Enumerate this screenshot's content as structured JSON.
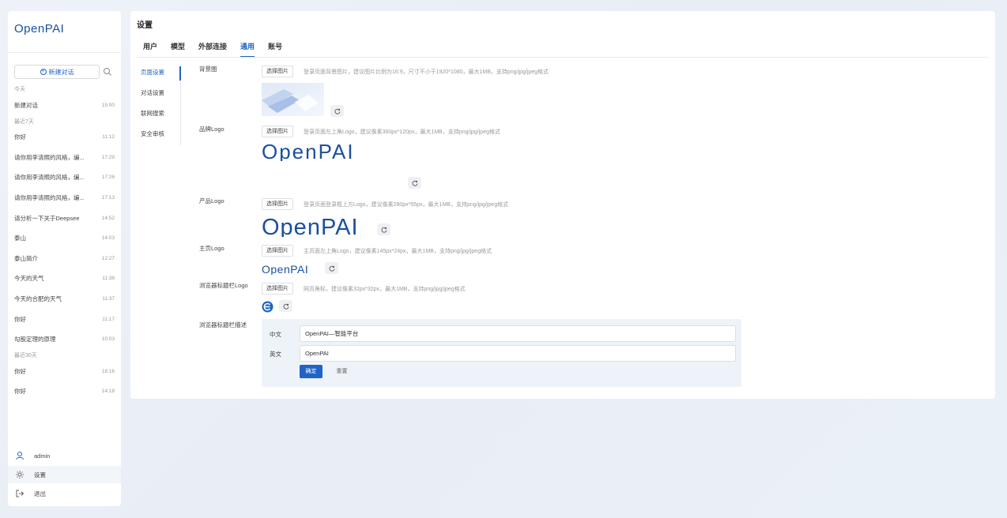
{
  "app": {
    "brand": "OpenPAI"
  },
  "sidebar": {
    "new_chat_label": "新建对话",
    "groups": [
      {
        "label": "今天",
        "items": [
          {
            "title": "新建对话",
            "time": "15:00"
          }
        ]
      },
      {
        "label": "最近7天",
        "items": [
          {
            "title": "你好",
            "time": "11:12"
          },
          {
            "title": "请你用李清照的风格，编...",
            "time": "17:29"
          },
          {
            "title": "请你用李清照的风格，编...",
            "time": "17:26"
          },
          {
            "title": "请你用李清照的风格，编...",
            "time": "17:13"
          },
          {
            "title": "请分析一下关于Deepsee",
            "time": "14:52"
          },
          {
            "title": "泰山",
            "time": "14:03"
          },
          {
            "title": "泰山简介",
            "time": "12:27"
          },
          {
            "title": "今天的天气",
            "time": "11:38"
          },
          {
            "title": "今天的合肥的天气",
            "time": "11:37"
          },
          {
            "title": "你好",
            "time": "11:17"
          },
          {
            "title": "勾股定理的原理",
            "time": "10:03"
          }
        ]
      },
      {
        "label": "最近30天",
        "items": [
          {
            "title": "你好",
            "time": "18:16"
          },
          {
            "title": "你好",
            "time": "14:18"
          }
        ]
      }
    ],
    "user": "admin",
    "settings_label": "设置",
    "logout_label": "退出"
  },
  "main": {
    "title": "设置",
    "tabs": [
      {
        "label": "用户",
        "active": false
      },
      {
        "label": "模型",
        "active": false
      },
      {
        "label": "外部连接",
        "active": false
      },
      {
        "label": "通用",
        "active": true
      },
      {
        "label": "账号",
        "active": false
      }
    ],
    "subnav": [
      {
        "label": "页面设置",
        "active": true
      },
      {
        "label": "对话设置",
        "active": false
      },
      {
        "label": "联网搜索",
        "active": false
      },
      {
        "label": "安全审核",
        "active": false
      }
    ],
    "pick_label": "选择图片",
    "rows": {
      "background": {
        "label": "背景图",
        "hint": "登录页面背景图片，建议图片比例为16:9，尺寸不小于1920*1080，最大1MB，支持png/jpg/jpeg格式"
      },
      "brand_logo": {
        "label": "品牌Logo",
        "hint": "登录页面左上角Logo，建议像素360px*120px，最大1MB，支持png/jpg/jpeg格式"
      },
      "product_logo": {
        "label": "产品Logo",
        "hint": "登录页面登录框上方Logo，建议像素280px*55px，最大1MB，支持png/jpg/jpeg格式"
      },
      "home_logo": {
        "label": "主页Logo",
        "hint": "主页面左上角Logo，建议像素145px*24px，最大1MB，支持png/jpg/jpeg格式"
      },
      "favicon": {
        "label": "浏览器标题栏Logo",
        "hint": "网页角标，建议像素32px*32px，最大1MB，支持png/jpg/jpeg格式"
      },
      "browser_desc": {
        "label": "浏览器标题栏描述"
      }
    },
    "desc_form": {
      "zh_label": "中文",
      "zh_value": "OpenPAI—智能平台",
      "en_label": "英文",
      "en_value": "OpenPAI",
      "ok_label": "确定",
      "reset_label": "重置"
    }
  },
  "colors": {
    "accent": "#1f63c6",
    "logo": "#1a4fa0"
  }
}
